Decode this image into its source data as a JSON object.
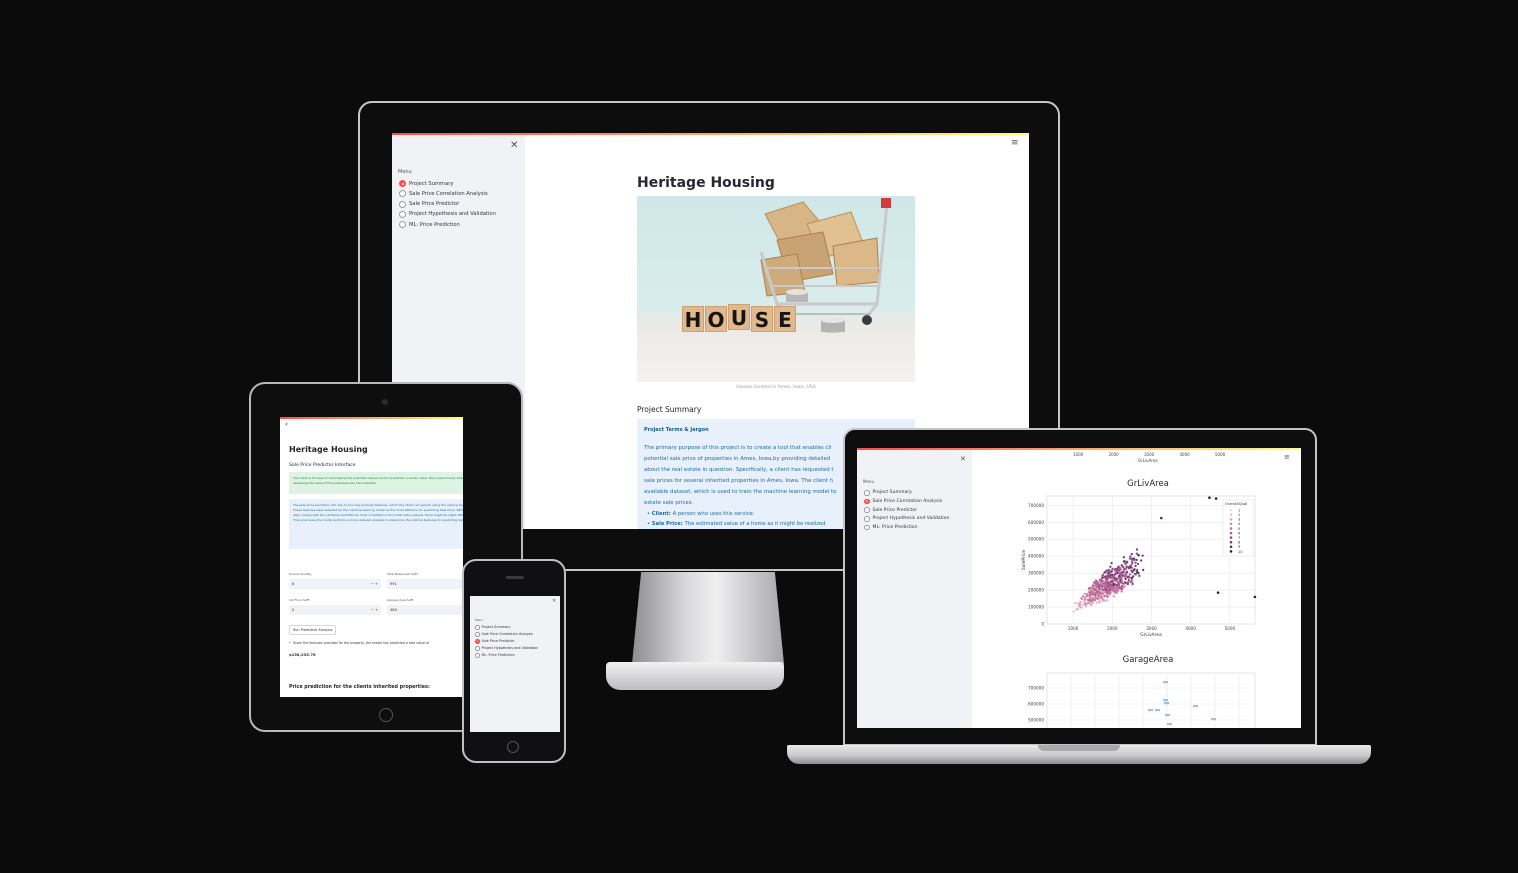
{
  "app": {
    "title": "Heritage Housing",
    "menu_label": "Menu",
    "menu_items": [
      "Project Summary",
      "Sale Price Correlation Analysis",
      "Sale Price Predictor",
      "Project Hypothesis and Validation",
      "ML: Price Prediction"
    ]
  },
  "desktop": {
    "selected_menu": "Project Summary",
    "image_word": "HOUSE",
    "image_caption": "Houses located in Ames, Iowa, USA",
    "section_title": "Project Summary",
    "info_title": "Project Terms & Jargon",
    "info_paragraph_lines": [
      "The primary purpose of this project is to create a tool that enables cli",
      "potential sale price of properties in Ames, Iowa,by providing detailed",
      "about the real estate in question. Specifically, a client has requested t",
      "sale prices for several inherited properties in Ames, Iowa. The client h",
      "available dataset, which is used to train the machine learning model to",
      "estate sale prices."
    ],
    "bullets": [
      {
        "term": "Client:",
        "text": "A person who uses this service."
      },
      {
        "term": "Sale Price:",
        "text": "The estimated value of a home as it might be realized"
      }
    ]
  },
  "tablet": {
    "subtitle": "Sale Price Predictor Interface",
    "success_text": "The client is focused on forecasting the potential sale prices for properties in Ames, Iowa. She is particularly interested in assessing the value of the properties she has inherited.",
    "info_text": "The sale price prediction will rely on four key property features, which the client can specify using the options below. These features were selected by the machine learning model as the most effective for predicting Sale Price. While they align closely with the variables identified as most correlated in the initial data analysis, there might be slight differences. This is because the model performs a more detailed analysis to determine the optimal features for predicting Sale Price.",
    "fields": [
      {
        "label": "Overall Quality",
        "value": "6"
      },
      {
        "label": "Total Basement SqFt",
        "value": "991"
      },
      {
        "label": "1st Floor SqFt",
        "value": "0"
      },
      {
        "label": "Garage Area SqFt",
        "value": "480"
      }
    ],
    "run_button": "Run Predictive Analysis",
    "result_text": "Given the features provided for the property, the model has predicted a sale value of",
    "result_value": "$158,235.76",
    "bottom_heading": "Price prediction for the clients inherited properties:"
  },
  "phone": {
    "selected_menu": "Sale Price Predictor"
  },
  "laptop": {
    "selected_menu": "Sale Price Correlation Analysis",
    "prev_chart_ticks": [
      "1000",
      "2000",
      "3000",
      "4000",
      "5000"
    ],
    "prev_chart_xlabel": "GrLivArea",
    "chart_data": [
      {
        "type": "scatter",
        "title": "GrLivArea",
        "xlabel": "GrLivArea",
        "ylabel": "SalePrice",
        "x_ticks": [
          "1000",
          "2000",
          "3000",
          "4000",
          "5000"
        ],
        "y_ticks": [
          "0",
          "100000",
          "200000",
          "300000",
          "400000",
          "500000",
          "600000",
          "700000"
        ],
        "legend_title": "OverallQual",
        "legend": [
          "1",
          "2",
          "3",
          "4",
          "5",
          "6",
          "7",
          "8",
          "9",
          "10"
        ],
        "xlim": [
          334,
          5642
        ],
        "ylim": [
          0,
          755000
        ],
        "grid": true,
        "legend_position": "top-right",
        "colors": [
          "#f2dfe6",
          "#e9c3d1",
          "#dfa6bd",
          "#d38aa9",
          "#c56f98",
          "#b15b91",
          "#964b87",
          "#743c7a",
          "#4f2c63",
          "#2d1b47"
        ]
      },
      {
        "type": "scatter",
        "title": "GarageArea",
        "y_ticks": [
          "700000",
          "600000",
          "500000"
        ],
        "grid": true,
        "color": "#7fb3e8"
      }
    ]
  }
}
